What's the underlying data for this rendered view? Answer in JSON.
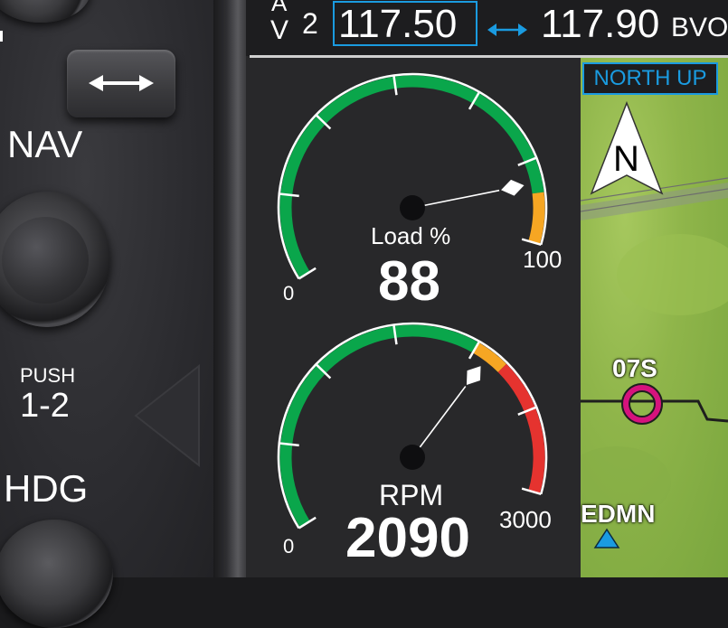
{
  "bezel": {
    "nav_label": "NAV",
    "push_label": "PUSH",
    "push_value": "1-2",
    "hdg_label": "HDG"
  },
  "radio": {
    "top_letter": "A",
    "bottom_letter": "V",
    "channel": "2",
    "active_freq": "117.50",
    "standby_freq": "117.90",
    "station_id": "BVO"
  },
  "gauges": {
    "load": {
      "label": "Load %",
      "value": 88,
      "display": "88",
      "min_label": "0",
      "max_label": "100",
      "min": 0,
      "max": 100,
      "green_end": 90
    },
    "rpm": {
      "label": "RPM",
      "value": 2090,
      "display": "2090",
      "min_label": "0",
      "max_label": "3000",
      "min": 0,
      "max": 3000,
      "green_end": 2000,
      "amber_end": 2200
    }
  },
  "map": {
    "orientation": "NORTH UP",
    "north_label": "N",
    "airport_1": "07S",
    "airport_2": "EDMN"
  },
  "colors": {
    "accent": "#1a9be0",
    "green": "#0aa64b",
    "amber": "#f6a623",
    "red": "#e5332f",
    "magenta": "#d6137d"
  }
}
